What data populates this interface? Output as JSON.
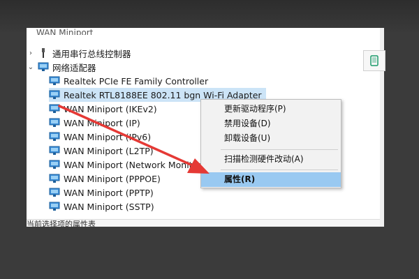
{
  "tree": {
    "partial_top": "WAN Miniport",
    "serial_bus": "通用串行总线控制器",
    "network_adapters": "网络适配器",
    "devices": [
      "Realtek PCIe FE Family Controller",
      "Realtek RTL8188EE 802.11 bgn Wi-Fi Adapter",
      "WAN Miniport (IKEv2)",
      "WAN Miniport (IP)",
      "WAN Miniport (IPv6)",
      "WAN Miniport (L2TP)",
      "WAN Miniport (Network Monitor)",
      "WAN Miniport (PPPOE)",
      "WAN Miniport (PPTP)",
      "WAN Miniport (SSTP)"
    ]
  },
  "status_text": "当前选择项的属性表",
  "context_menu": {
    "items": [
      "更新驱动程序(P)",
      "禁用设备(D)",
      "卸载设备(U)",
      "扫描检测硬件改动(A)",
      "属性(R)"
    ],
    "highlighted_index": 4
  },
  "icons": {
    "side_button": "device-icon",
    "network_adapter": "network-adapter-icon",
    "usb": "usb-icon"
  },
  "colors": {
    "selection": "#cce4f7",
    "menu_highlight": "#99c9f1",
    "arrow": "#e53935",
    "side_icon": "#1a9a6a"
  }
}
